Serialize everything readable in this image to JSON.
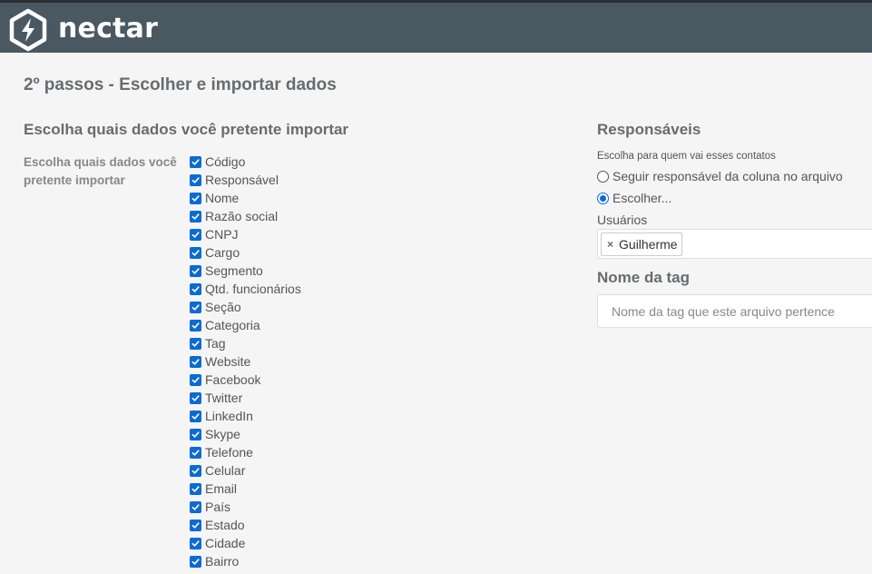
{
  "header": {
    "brand": "nectar",
    "colors": {
      "navbar": "#4a5862",
      "accent": "#0b6bd3"
    }
  },
  "page": {
    "title": "2º passos - Escolher e importar dados"
  },
  "import_section": {
    "title": "Escolha quais dados você pretente importar",
    "field_label": "Escolha quais dados você pretente importar",
    "fields": [
      {
        "label": "Código",
        "checked": true
      },
      {
        "label": "Responsável",
        "checked": true
      },
      {
        "label": "Nome",
        "checked": true
      },
      {
        "label": "Razão social",
        "checked": true
      },
      {
        "label": "CNPJ",
        "checked": true
      },
      {
        "label": "Cargo",
        "checked": true
      },
      {
        "label": "Segmento",
        "checked": true
      },
      {
        "label": "Qtd. funcionários",
        "checked": true
      },
      {
        "label": "Seção",
        "checked": true
      },
      {
        "label": "Categoria",
        "checked": true
      },
      {
        "label": "Tag",
        "checked": true
      },
      {
        "label": "Website",
        "checked": true
      },
      {
        "label": "Facebook",
        "checked": true
      },
      {
        "label": "Twitter",
        "checked": true
      },
      {
        "label": "LinkedIn",
        "checked": true
      },
      {
        "label": "Skype",
        "checked": true
      },
      {
        "label": "Telefone",
        "checked": true
      },
      {
        "label": "Celular",
        "checked": true
      },
      {
        "label": "Email",
        "checked": true
      },
      {
        "label": "País",
        "checked": true
      },
      {
        "label": "Estado",
        "checked": true
      },
      {
        "label": "Cidade",
        "checked": true
      },
      {
        "label": "Bairro",
        "checked": true
      }
    ]
  },
  "responsaveis": {
    "title": "Responsáveis",
    "help": "Escolha para quem vai esses contatos",
    "options": [
      {
        "label": "Seguir responsável da coluna no arquivo",
        "selected": false
      },
      {
        "label": "Escolher...",
        "selected": true
      }
    ],
    "users_label": "Usuários",
    "selected_users": [
      "Guilherme"
    ],
    "remove_glyph": "×"
  },
  "tag": {
    "title": "Nome da tag",
    "placeholder": "Nome da tag que este arquivo pertence",
    "value": ""
  }
}
